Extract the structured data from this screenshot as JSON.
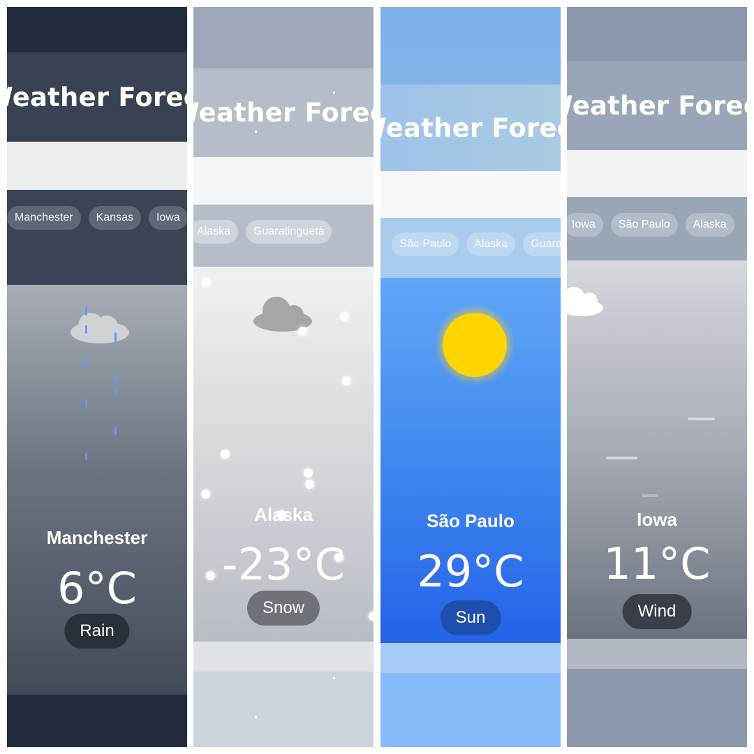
{
  "title": "Weather Forecast",
  "panels": [
    {
      "city": "Manchester",
      "temperature": "6°C",
      "condition": "Rain",
      "chips": [
        "Manchester",
        "Kansas",
        "Iowa"
      ],
      "weather_icon": "rain-cloud-icon",
      "accent_color": "#5aa0f2"
    },
    {
      "city": "Alaska",
      "temperature": "-23°C",
      "condition": "Snow",
      "chips": [
        "Alaska",
        "Guaratinguetá"
      ],
      "weather_icon": "snow-cloud-icon",
      "accent_color": "#ffffff"
    },
    {
      "city": "São Paulo",
      "temperature": "29°C",
      "condition": "Sun",
      "chip_prefix": ":",
      "chips": [
        "São Paulo",
        "Alaska",
        "Guarat"
      ],
      "weather_icon": "sun-icon",
      "accent_color": "#ffd500"
    },
    {
      "city": "Iowa",
      "temperature": "11°C",
      "condition": "Wind",
      "chips": [
        "Iowa",
        "São Paulo",
        "Alaska"
      ],
      "weather_icon": "wind-cloud-icon",
      "accent_color": "#ffffff"
    }
  ]
}
